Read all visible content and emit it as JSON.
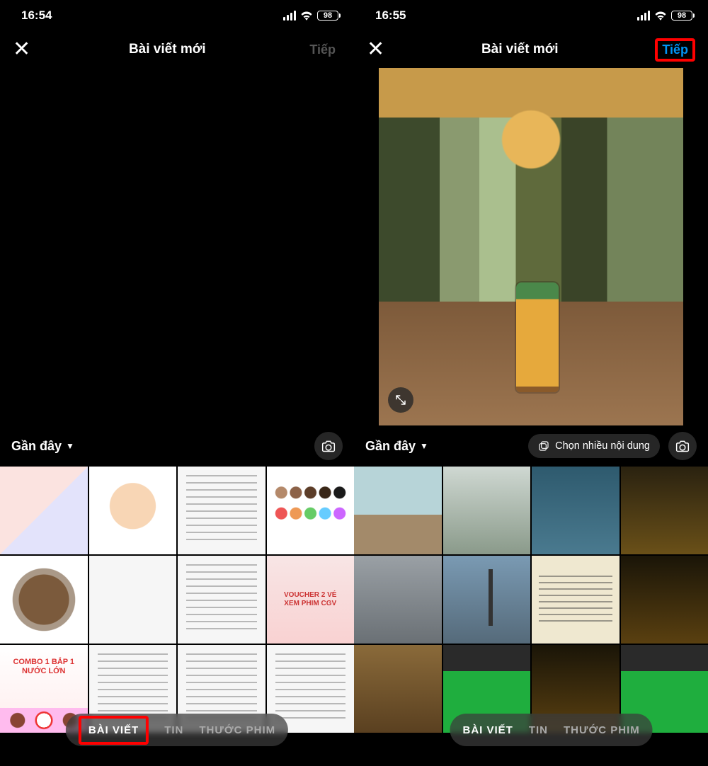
{
  "screens": [
    {
      "status": {
        "time": "16:54",
        "battery_pct": "98"
      },
      "header": {
        "title": "Bài viết mới",
        "next_label": "Tiếp",
        "next_enabled": false
      },
      "preview": "empty",
      "gallery": {
        "album": "Gần đây",
        "multi_label": null,
        "modes": {
          "post": "BÀI VIẾT",
          "story": "TIN",
          "reel": "THƯỚC PHIM"
        },
        "thumbs": {
          "r2c3_voucher_line1": "VOUCHER 2 VÉ",
          "r2c3_voucher_line2": "XEM PHIM CGV",
          "r3c0_combo_line1": "COMBO 1 BẮP 1",
          "r3c0_combo_line2": "NƯỚC LỚN"
        }
      }
    },
    {
      "status": {
        "time": "16:55",
        "battery_pct": "98"
      },
      "header": {
        "title": "Bài viết mới",
        "next_label": "Tiếp",
        "next_enabled": true
      },
      "preview": "photo",
      "gallery": {
        "album": "Gần đây",
        "multi_label": "Chọn nhiều nội dung",
        "modes": {
          "post": "BÀI VIẾT",
          "story": "TIN",
          "reel": "THƯỚC PHIM"
        }
      }
    }
  ]
}
